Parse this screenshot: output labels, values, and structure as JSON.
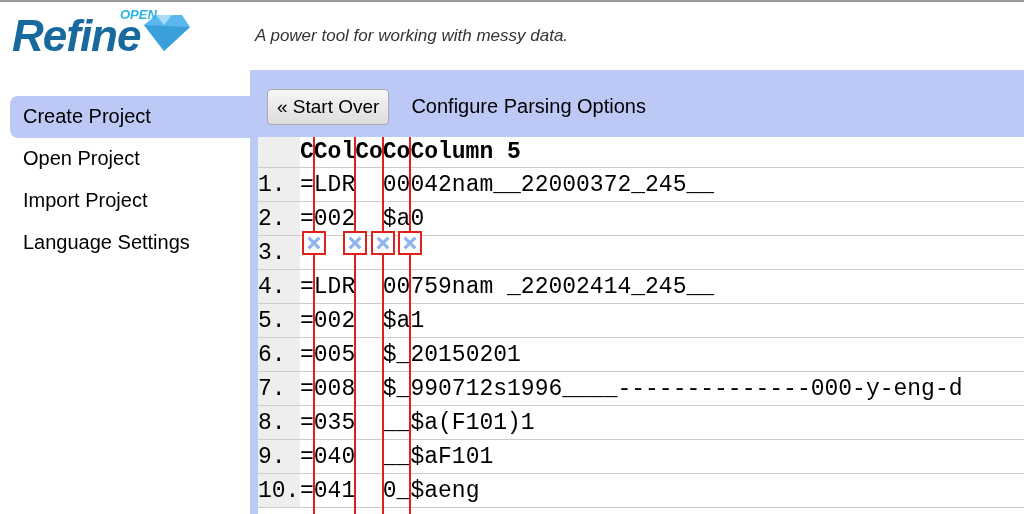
{
  "logo": {
    "word": "Refine",
    "tag": "OPEN"
  },
  "tagline": "A power tool for working with messy data.",
  "sidebar": {
    "items": [
      {
        "label": "Create Project",
        "selected": true
      },
      {
        "label": "Open Project",
        "selected": false
      },
      {
        "label": "Import Project",
        "selected": false
      },
      {
        "label": "Language Settings",
        "selected": false
      }
    ]
  },
  "toolbar": {
    "button": "« Start Over",
    "title": "Configure Parsing Options"
  },
  "preview": {
    "columns": [
      "C",
      "Col",
      "Co",
      "Co",
      "Column 5"
    ],
    "rows": [
      {
        "number": "1.",
        "line": "=LDR  00042nam__22000372_245__"
      },
      {
        "number": "2.",
        "line": "=002  $a0"
      },
      {
        "number": "3."
      },
      {
        "number": "4.",
        "line": "=LDR  00759nam _22002414_245__"
      },
      {
        "number": "5.",
        "line": "=002  $a1"
      },
      {
        "number": "6.",
        "line": "=005  $_20150201"
      },
      {
        "number": "7.",
        "line": "=008  $_990712s1996____--------------000-y-eng-d"
      },
      {
        "number": "8.",
        "line": "=035  __$a(F101)1"
      },
      {
        "number": "9.",
        "line": "=040  __$aF101"
      },
      {
        "number": "10.",
        "line": "=041  0_$aeng"
      }
    ]
  }
}
